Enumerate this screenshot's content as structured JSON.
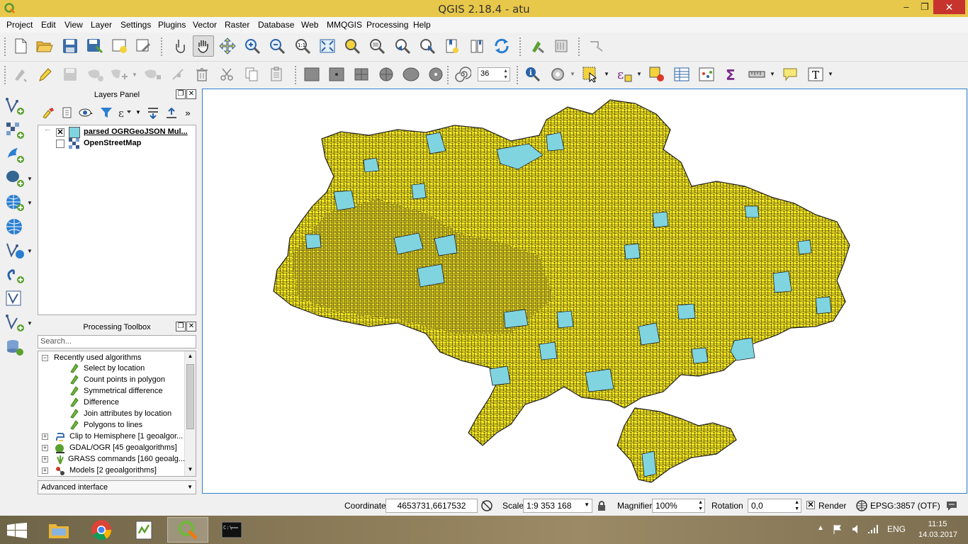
{
  "window": {
    "title": "QGIS 2.18.4 - atu",
    "app_icon": "qgis-logo-icon",
    "controls": [
      "minimize",
      "maximize",
      "close"
    ]
  },
  "menu": [
    "Project",
    "Edit",
    "View",
    "Layer",
    "Settings",
    "Plugins",
    "Vector",
    "Raster",
    "Database",
    "Web",
    "MMQGIS",
    "Processing",
    "Help"
  ],
  "toolbar": {
    "snapping_tolerance": "36"
  },
  "layers_panel": {
    "title": "Layers Panel",
    "layers": [
      {
        "name": "parsed OGRGeoJSON Mul...",
        "checked": true,
        "icon": "polygon-layer-icon",
        "swatch_color": "#7fd4e0"
      },
      {
        "name": "OpenStreetMap",
        "checked": false,
        "icon": "raster-tiles-icon"
      }
    ]
  },
  "processing_toolbox": {
    "title": "Processing Toolbox",
    "search_placeholder": "Search...",
    "recent_group": "Recently used algorithms",
    "recent": [
      "Select by location",
      "Count points in polygon",
      "Symmetrical difference",
      "Difference",
      "Join attributes by location",
      "Polygons to lines"
    ],
    "providers": [
      {
        "label": "Clip to Hemisphere [1 geoalgor...",
        "icon": "python-icon"
      },
      {
        "label": "GDAL/OGR [45 geoalgorithms]",
        "icon": "gdal-icon"
      },
      {
        "label": "GRASS commands [160 geoalg...",
        "icon": "grass-icon"
      },
      {
        "label": "Models [2 geoalgorithms]",
        "icon": "models-icon"
      }
    ],
    "interface_mode": "Advanced interface"
  },
  "map": {
    "fill_color": "#ffef1e",
    "stroke_color": "#222222",
    "water_color": "#7fd4e0"
  },
  "status": {
    "coordinate_label": "Coordinate",
    "coordinate_value": "4653731,6617532",
    "scale_label": "Scale",
    "scale_value": "1:9 353 168",
    "magnifier_label": "Magnifier",
    "magnifier_value": "100%",
    "rotation_label": "Rotation",
    "rotation_value": "0,0",
    "render_label": "Render",
    "render_checked": true,
    "crs": "EPSG:3857 (OTF)"
  },
  "taskbar": {
    "language": "ENG",
    "time": "11:15",
    "date": "14.03.2017",
    "apps": [
      "file-explorer-icon",
      "chrome-icon",
      "editor-icon",
      "qgis-icon",
      "terminal-icon"
    ]
  }
}
